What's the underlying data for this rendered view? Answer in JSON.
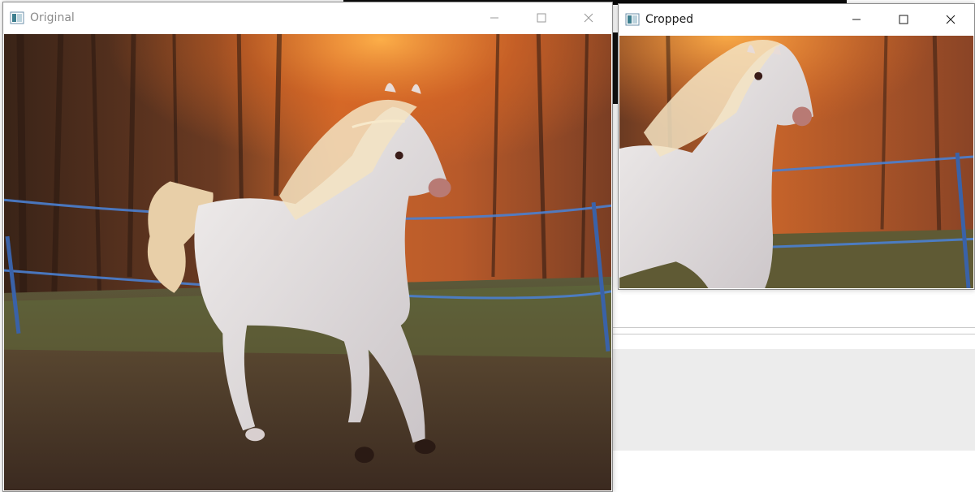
{
  "windows": {
    "original": {
      "title": "Original",
      "icon": "opencv-window-icon",
      "image_subject": "white-horse-running-at-sunset"
    },
    "cropped": {
      "title": "Cropped",
      "icon": "opencv-window-icon",
      "image_subject": "white-horse-head-and-shoulders-crop"
    }
  },
  "controls": [
    "minimize-icon",
    "maximize-icon",
    "close-icon"
  ],
  "colors": {
    "background_text": "#19c7c7",
    "sunset_orange": "#d9692a",
    "fence_blue": "#4a7fd0",
    "ground_brown": "#4a3426"
  }
}
